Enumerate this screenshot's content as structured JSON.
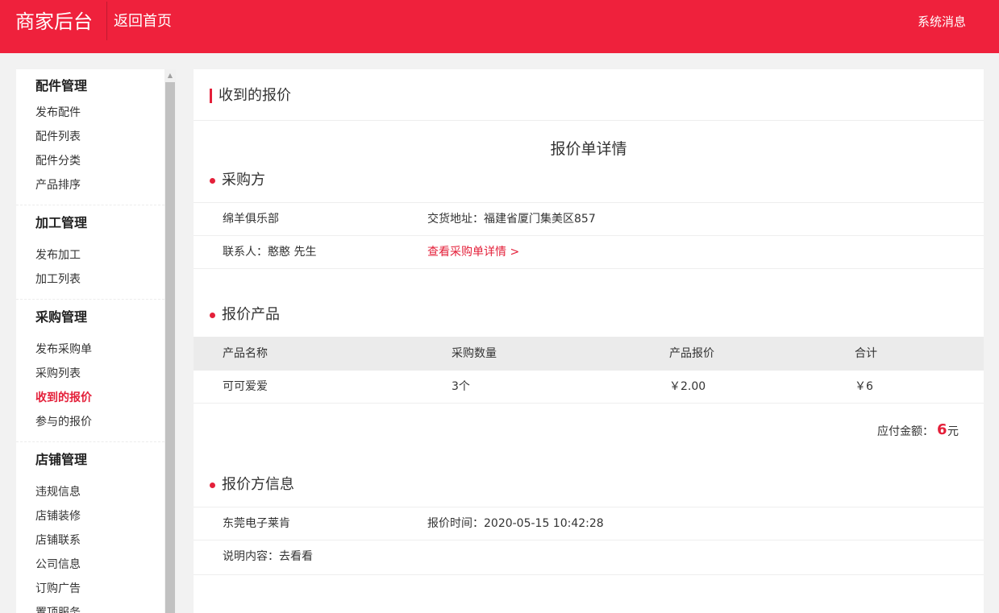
{
  "header": {
    "brand": "商家后台",
    "home_link": "返回首页",
    "system_messages": "系统消息"
  },
  "sidebar": {
    "groups": [
      {
        "title": "配件管理",
        "items": [
          "发布配件",
          "配件列表",
          "配件分类",
          "产品排序"
        ]
      },
      {
        "title": "加工管理",
        "items": [
          "发布加工",
          "加工列表"
        ]
      },
      {
        "title": "采购管理",
        "items": [
          "发布采购单",
          "采购列表",
          "收到的报价",
          "参与的报价"
        ]
      },
      {
        "title": "店铺管理",
        "items": [
          "违规信息",
          "店铺装修",
          "店铺联系",
          "公司信息",
          "订购广告",
          "置顶服务"
        ]
      }
    ],
    "active_item": "收到的报价"
  },
  "main": {
    "page_title": "收到的报价",
    "doc_title": "报价单详情",
    "buyer": {
      "section_title": "采购方",
      "name": "绵羊俱乐部",
      "address": "交货地址：福建省厦门集美区857",
      "contact": "联系人：憨憨 先生",
      "detail_link": "查看采购单详情 >"
    },
    "products": {
      "section_title": "报价产品",
      "columns": [
        "产品名称",
        "采购数量",
        "产品报价",
        "合计"
      ],
      "rows": [
        [
          "可可爱爱",
          "3个",
          "￥2.00",
          "￥6"
        ]
      ],
      "total_label": "应付金额：",
      "total_value": "6",
      "total_unit": "元"
    },
    "quoter": {
      "section_title": "报价方信息",
      "name": "东莞电子莱肯",
      "quote_time": "报价时间：2020-05-15 10:42:28",
      "description": "说明内容：去看看"
    }
  },
  "colors": {
    "brand_red": "#ef213c",
    "accent_red": "#e4203a"
  }
}
